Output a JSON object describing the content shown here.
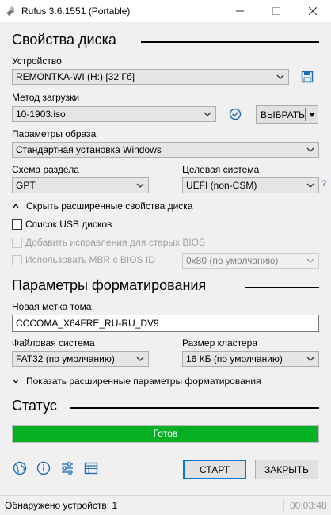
{
  "window": {
    "title": "Rufus 3.6.1551 (Portable)",
    "minimize": "—",
    "maximize": "☐",
    "close": "✕"
  },
  "drive_props": {
    "title": "Свойства диска",
    "device_label": "Устройство",
    "device_value": "REMONTKA-WI (H:) [32 Гб]",
    "boot_label": "Метод загрузки",
    "boot_value": "10-1903.iso",
    "select_button": "ВЫБРАТЬ",
    "image_label": "Параметры образа",
    "image_value": "Стандартная установка Windows",
    "partition_label": "Схема раздела",
    "partition_value": "GPT",
    "target_label": "Целевая система",
    "target_value": "UEFI (non-CSM)",
    "help": "?",
    "advanced_toggle": "Скрыть расширенные свойства диска",
    "usb_list": "Список USB дисков",
    "old_bios_fix": "Добавить исправления для старых BIOS",
    "use_mbr": "Использовать MBR с BIOS ID",
    "bios_id_value": "0x80 (по умолчанию)"
  },
  "format": {
    "title": "Параметры форматирования",
    "volume_label": "Новая метка тома",
    "volume_value": "CCCOMA_X64FRE_RU-RU_DV9",
    "fs_label": "Файловая система",
    "fs_value": "FAT32 (по умолчанию)",
    "cluster_label": "Размер кластера",
    "cluster_value": "16 КБ (по умолчанию)",
    "advanced_toggle": "Показать расширенные параметры форматирования"
  },
  "status": {
    "title": "Статус",
    "progress_text": "Готов",
    "progress_fraction": 1.0
  },
  "actions": {
    "start": "СТАРТ",
    "close": "ЗАКРЫТЬ"
  },
  "statusbar": {
    "devices": "Обнаружено устройств: 1",
    "timer": "00:03:48"
  },
  "colors": {
    "progress": "#06b025",
    "accent": "#0078d7",
    "icon_blue": "#1e6bb8"
  }
}
